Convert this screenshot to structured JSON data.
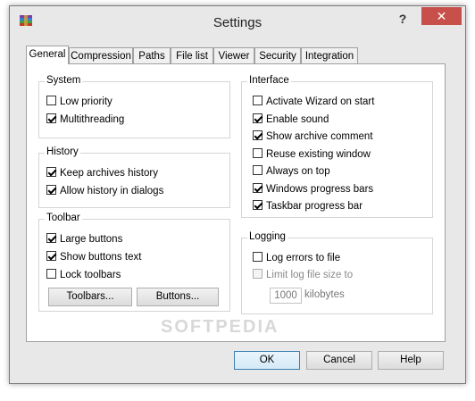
{
  "window": {
    "title": "Settings",
    "help_label": "?",
    "close_label": "✕"
  },
  "tabs": [
    {
      "label": "General",
      "active": true
    },
    {
      "label": "Compression"
    },
    {
      "label": "Paths"
    },
    {
      "label": "File list"
    },
    {
      "label": "Viewer"
    },
    {
      "label": "Security"
    },
    {
      "label": "Integration"
    }
  ],
  "system": {
    "title": "System",
    "items": [
      {
        "label": "Low priority",
        "checked": false
      },
      {
        "label": "Multithreading",
        "checked": true
      }
    ]
  },
  "history": {
    "title": "History",
    "items": [
      {
        "label": "Keep archives history",
        "checked": true
      },
      {
        "label": "Allow history in dialogs",
        "checked": true
      }
    ]
  },
  "toolbar": {
    "title": "Toolbar",
    "items": [
      {
        "label": "Large buttons",
        "checked": true
      },
      {
        "label": "Show buttons text",
        "checked": true
      },
      {
        "label": "Lock toolbars",
        "checked": false
      }
    ],
    "toolbars_button": "Toolbars...",
    "buttons_button": "Buttons..."
  },
  "interface": {
    "title": "Interface",
    "items": [
      {
        "label": "Activate Wizard on start",
        "checked": false
      },
      {
        "label": "Enable sound",
        "checked": true
      },
      {
        "label": "Show archive comment",
        "checked": true
      },
      {
        "label": "Reuse existing window",
        "checked": false
      },
      {
        "label": "Always on top",
        "checked": false
      },
      {
        "label": "Windows progress bars",
        "checked": true
      },
      {
        "label": "Taskbar progress bar",
        "checked": true
      }
    ]
  },
  "logging": {
    "title": "Logging",
    "log_errors": {
      "label": "Log errors to file",
      "checked": false
    },
    "limit_size": {
      "label": "Limit log file size to",
      "checked": false
    },
    "size_value": "1000",
    "size_unit": "kilobytes"
  },
  "footer": {
    "ok": "OK",
    "cancel": "Cancel",
    "help": "Help"
  },
  "watermark": "SOFTPEDIA"
}
